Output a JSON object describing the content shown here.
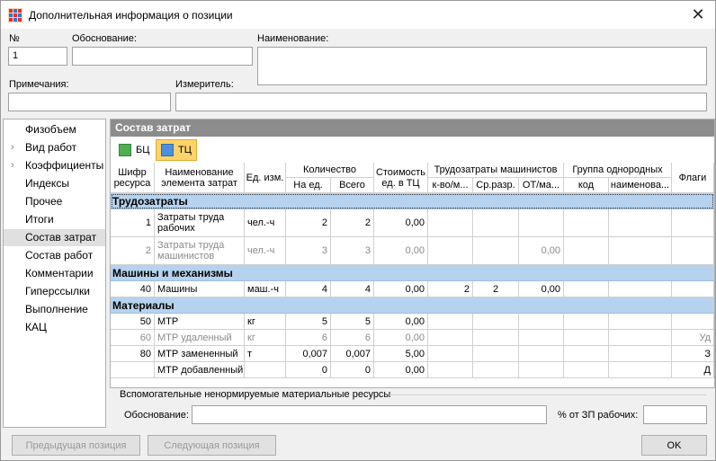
{
  "window": {
    "title": "Дополнительная информация о позиции",
    "icon": "table-app-icon",
    "close_icon": "close-icon"
  },
  "fields": {
    "number_label": "№",
    "number_value": "1",
    "justification_label": "Обоснование:",
    "justification_value": "",
    "name_label": "Наименование:",
    "name_value": "",
    "notes_label": "Примечания:",
    "notes_value": "",
    "unit_label": "Измеритель:",
    "unit_value": ""
  },
  "sidebar": {
    "items": [
      {
        "label": "Физобъем",
        "expandable": false
      },
      {
        "label": "Вид работ",
        "expandable": true
      },
      {
        "label": "Коэффициенты",
        "expandable": true
      },
      {
        "label": "Индексы",
        "expandable": false
      },
      {
        "label": "Прочее",
        "expandable": false
      },
      {
        "label": "Итоги",
        "expandable": false
      },
      {
        "label": "Состав затрат",
        "expandable": false,
        "selected": true
      },
      {
        "label": "Состав работ",
        "expandable": false
      },
      {
        "label": "Комментарии",
        "expandable": false
      },
      {
        "label": "Гиперссылки",
        "expandable": false
      },
      {
        "label": "Выполнение",
        "expandable": false
      },
      {
        "label": "КАЦ",
        "expandable": false
      }
    ]
  },
  "panel": {
    "title": "Состав затрат",
    "toolbar": [
      {
        "label": "БЦ",
        "color": "#4caf50",
        "active": false
      },
      {
        "label": "ТЦ",
        "color": "#4a8fe0",
        "active": true
      }
    ]
  },
  "table": {
    "headers": {
      "code": "Шифр ресурса",
      "name": "Наименование элемента затрат",
      "unit": "Ед. изм.",
      "quantity": "Количество",
      "qty_per_unit": "На ед.",
      "qty_total": "Всего",
      "cost": "Стоимость ед. в ТЦ",
      "machine_labor": "Трудозатраты машинистов",
      "ml_qty": "к-во/м...",
      "ml_grade": "Ср.разр.",
      "ml_ot": "ОТ/ма...",
      "group": "Группа однородных",
      "group_code": "код",
      "group_name": "наименова...",
      "flags": "Флаги"
    },
    "groups": [
      {
        "title": "Трудозатраты",
        "selected": true,
        "rows": [
          {
            "code": "1",
            "name": "Затраты труда рабочих",
            "unit": "чел.-ч",
            "per_unit": "2",
            "total": "2",
            "cost": "0,00",
            "ml_qty": "",
            "ml_grade": "",
            "ml_ot": "",
            "g_code": "",
            "g_name": "",
            "flags": "",
            "dim": false,
            "tall": true
          },
          {
            "code": "2",
            "name": "Затраты труда машинистов",
            "unit": "чел.-ч",
            "per_unit": "3",
            "total": "3",
            "cost": "0,00",
            "ml_qty": "",
            "ml_grade": "",
            "ml_ot": "0,00",
            "g_code": "",
            "g_name": "",
            "flags": "",
            "dim": true,
            "tall": true
          }
        ]
      },
      {
        "title": "Машины и механизмы",
        "selected": false,
        "rows": [
          {
            "code": "40",
            "name": "Машины",
            "unit": "маш.-ч",
            "per_unit": "4",
            "total": "4",
            "cost": "0,00",
            "ml_qty": "2",
            "ml_grade": "2",
            "ml_ot": "0,00",
            "g_code": "",
            "g_name": "",
            "flags": "",
            "dim": false,
            "tall": false
          }
        ]
      },
      {
        "title": "Материалы",
        "selected": false,
        "rows": [
          {
            "code": "50",
            "name": "МТР",
            "unit": "кг",
            "per_unit": "5",
            "total": "5",
            "cost": "0,00",
            "ml_qty": "",
            "ml_grade": "",
            "ml_ot": "",
            "g_code": "",
            "g_name": "",
            "flags": "",
            "dim": false,
            "tall": false
          },
          {
            "code": "60",
            "name": "МТР удаленный",
            "unit": "кг",
            "per_unit": "6",
            "total": "6",
            "cost": "0,00",
            "ml_qty": "",
            "ml_grade": "",
            "ml_ot": "",
            "g_code": "",
            "g_name": "",
            "flags": "Уд",
            "dim": true,
            "tall": false
          },
          {
            "code": "80",
            "name": "МТР замененный",
            "unit": "т",
            "per_unit": "0,007",
            "total": "0,007",
            "cost": "5,00",
            "ml_qty": "",
            "ml_grade": "",
            "ml_ot": "",
            "g_code": "",
            "g_name": "",
            "flags": "З",
            "dim": false,
            "tall": false
          },
          {
            "code": "",
            "name": "МТР добавленный",
            "unit": "",
            "per_unit": "0",
            "total": "0",
            "cost": "0,00",
            "ml_qty": "",
            "ml_grade": "",
            "ml_ot": "",
            "g_code": "",
            "g_name": "",
            "flags": "Д",
            "dim": false,
            "tall": false
          }
        ]
      }
    ]
  },
  "aux": {
    "title": "Вспомогательные ненормируемые материальные ресурсы",
    "justification_label": "Обоснование:",
    "justification_value": "",
    "percent_label": "% от ЗП рабочих:",
    "percent_value": ""
  },
  "buttons": {
    "prev": "Предыдущая позиция",
    "next": "Следующая позиция",
    "ok": "OK"
  }
}
